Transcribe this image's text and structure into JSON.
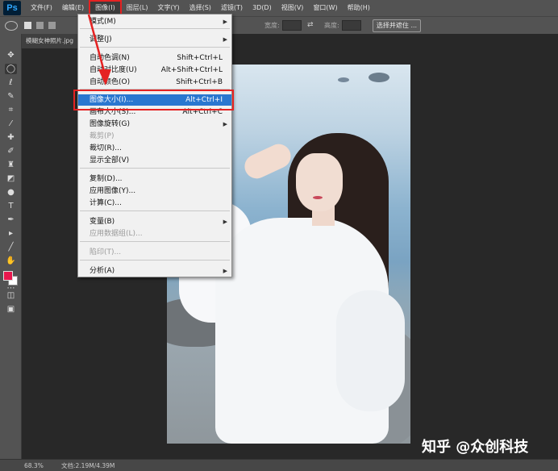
{
  "app": {
    "logo": "Ps"
  },
  "menubar": {
    "items": [
      "文件(F)",
      "编辑(E)",
      "图像(I)",
      "图层(L)",
      "文字(Y)",
      "选择(S)",
      "滤镜(T)",
      "3D(D)",
      "视图(V)",
      "窗口(W)",
      "帮助(H)"
    ],
    "active": "图像(I)"
  },
  "options_bar": {
    "width_label": "宽度:",
    "height_label": "高度:",
    "select_mask_button": "选择并遮住 ..."
  },
  "document": {
    "tab_title": "模糊女神照片.jpg"
  },
  "image_menu": {
    "items": [
      {
        "label": "模式(M)",
        "shortcut": "",
        "submenu": true,
        "disabled": false
      },
      {
        "label": "调整(J)",
        "shortcut": "",
        "submenu": true,
        "disabled": false
      },
      {
        "label": "自动色调(N)",
        "shortcut": "Shift+Ctrl+L",
        "submenu": false,
        "disabled": false
      },
      {
        "label": "自动对比度(U)",
        "shortcut": "Alt+Shift+Ctrl+L",
        "submenu": false,
        "disabled": false
      },
      {
        "label": "自动颜色(O)",
        "shortcut": "Shift+Ctrl+B",
        "submenu": false,
        "disabled": false
      },
      {
        "label": "图像大小(I)...",
        "shortcut": "Alt+Ctrl+I",
        "submenu": false,
        "disabled": false
      },
      {
        "label": "画布大小(S)...",
        "shortcut": "Alt+Ctrl+C",
        "submenu": false,
        "disabled": false
      },
      {
        "label": "图像旋转(G)",
        "shortcut": "",
        "submenu": true,
        "disabled": false
      },
      {
        "label": "裁剪(P)",
        "shortcut": "",
        "submenu": false,
        "disabled": true
      },
      {
        "label": "裁切(R)...",
        "shortcut": "",
        "submenu": false,
        "disabled": false
      },
      {
        "label": "显示全部(V)",
        "shortcut": "",
        "submenu": false,
        "disabled": false
      },
      {
        "label": "复制(D)...",
        "shortcut": "",
        "submenu": false,
        "disabled": false
      },
      {
        "label": "应用图像(Y)...",
        "shortcut": "",
        "submenu": false,
        "disabled": false
      },
      {
        "label": "计算(C)...",
        "shortcut": "",
        "submenu": false,
        "disabled": false
      },
      {
        "label": "变量(B)",
        "shortcut": "",
        "submenu": true,
        "disabled": false
      },
      {
        "label": "应用数据组(L)...",
        "shortcut": "",
        "submenu": false,
        "disabled": true
      },
      {
        "label": "陷印(T)...",
        "shortcut": "",
        "submenu": false,
        "disabled": true
      },
      {
        "label": "分析(A)",
        "shortcut": "",
        "submenu": true,
        "disabled": false
      }
    ],
    "highlighted": "图像大小(I)..."
  },
  "colors": {
    "foreground": "#e8174d",
    "background": "#ffffff",
    "accent_highlight": "#2a77d0",
    "annotation_red": "#e52222"
  },
  "statusbar": {
    "zoom": "68.3%",
    "doc_info": "文档:2.19M/4.39M"
  },
  "watermark": {
    "text": "知乎 @众创科技"
  }
}
